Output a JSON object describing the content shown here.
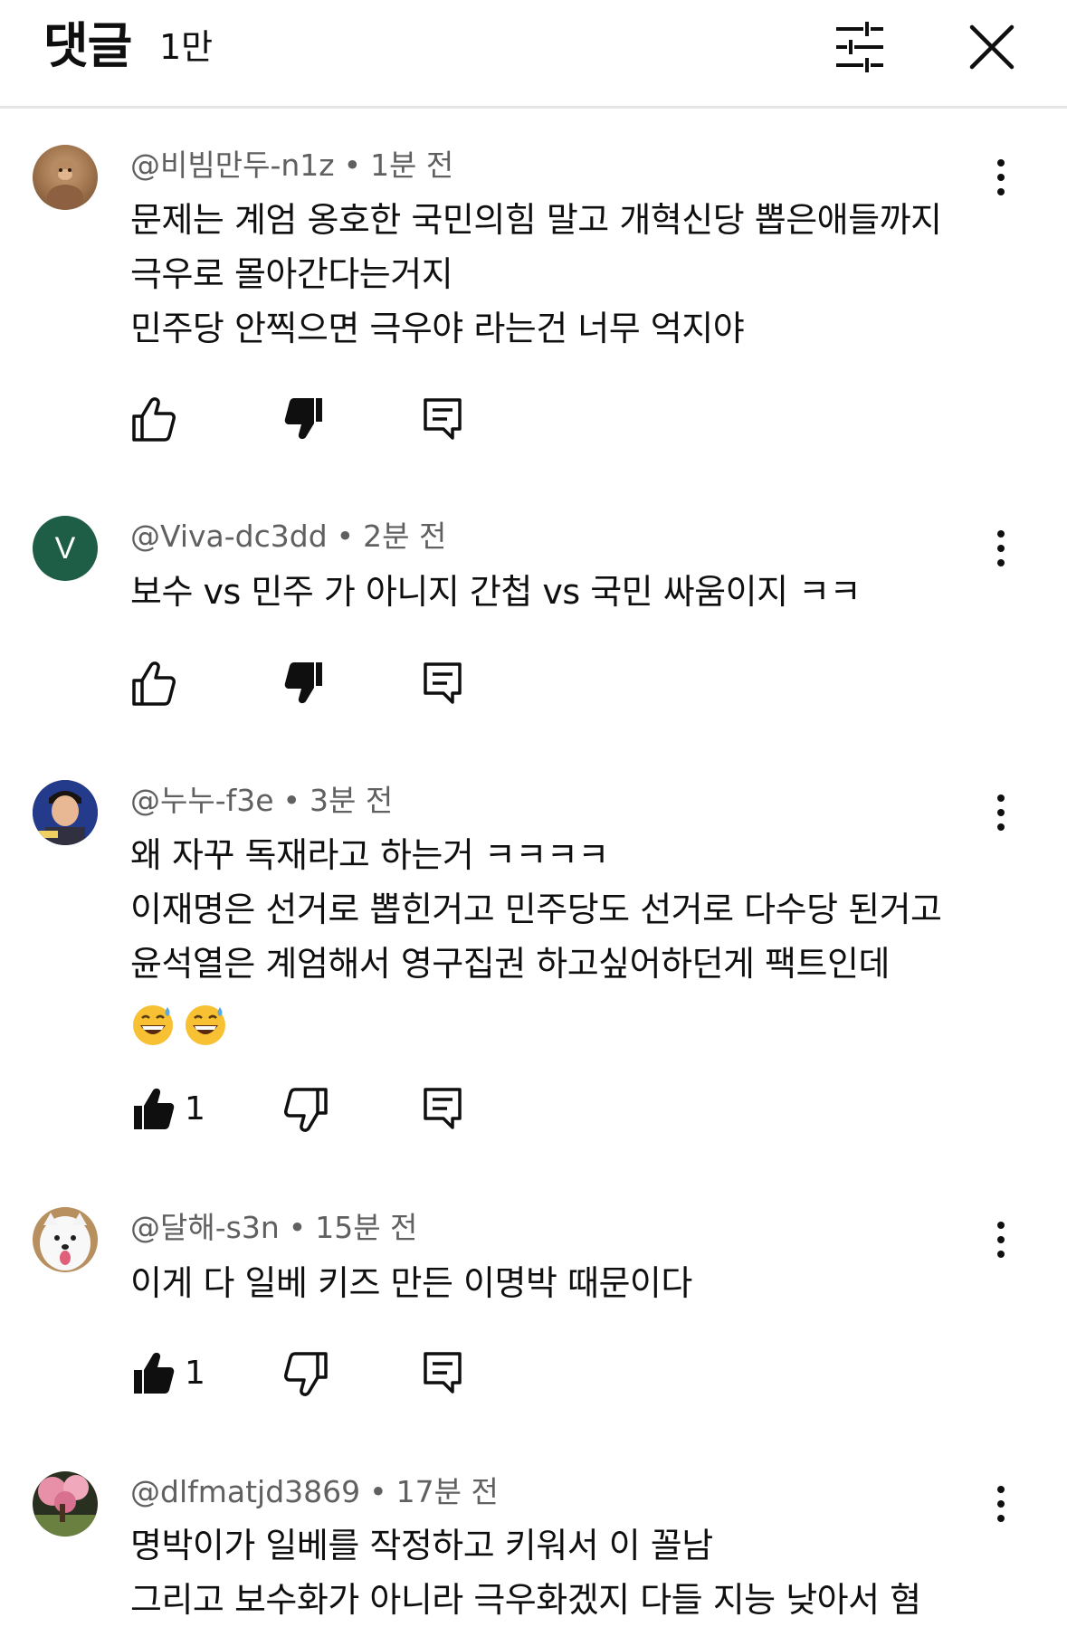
{
  "header": {
    "title": "댓글",
    "count": "1만"
  },
  "comments": [
    {
      "author": "@비빔만두-n1z",
      "time": "1분 전",
      "lines": [
        "문제는 계엄 옹호한 국민의힘 말고 개혁신당 뽑은애들까지",
        "극우로 몰아간다는거지",
        "민주당 안찍으면 극우야 라는건 너무 억지야"
      ],
      "likes": "",
      "avatar_letter": ""
    },
    {
      "author": "@Viva-dc3dd",
      "time": "2분 전",
      "lines": [
        "보수 vs 민주 가 아니지 간첩 vs 국민 싸움이지 ㅋㅋ"
      ],
      "likes": "",
      "avatar_letter": "V"
    },
    {
      "author": "@누누-f3e",
      "time": "3분 전",
      "lines": [
        "왜 자꾸 독재라고 하는거 ㅋㅋㅋㅋ",
        "이재명은 선거로 뽑힌거고 민주당도 선거로 다수당 된거고",
        "윤석열은 계엄해서 영구집권 하고싶어하던게 팩트인데"
      ],
      "likes": "1",
      "avatar_letter": ""
    },
    {
      "author": "@달해-s3n",
      "time": "15분 전",
      "lines": [
        "이게 다 일베 키즈 만든 이명박 때문이다"
      ],
      "likes": "1",
      "avatar_letter": ""
    },
    {
      "author": "@dlfmatjd3869",
      "time": "17분 전",
      "lines": [
        "명박이가 일베를 작정하고 키워서 이 꼴남",
        "그리고 보수화가 아니라 극우화겠지 다들 지능 낮아서 혐"
      ],
      "likes": "",
      "avatar_letter": ""
    }
  ],
  "colors": {
    "text": "#0f0f0f",
    "meta": "#606060",
    "divider": "#e5e5e5",
    "avatar_v": "#1e5d46"
  }
}
